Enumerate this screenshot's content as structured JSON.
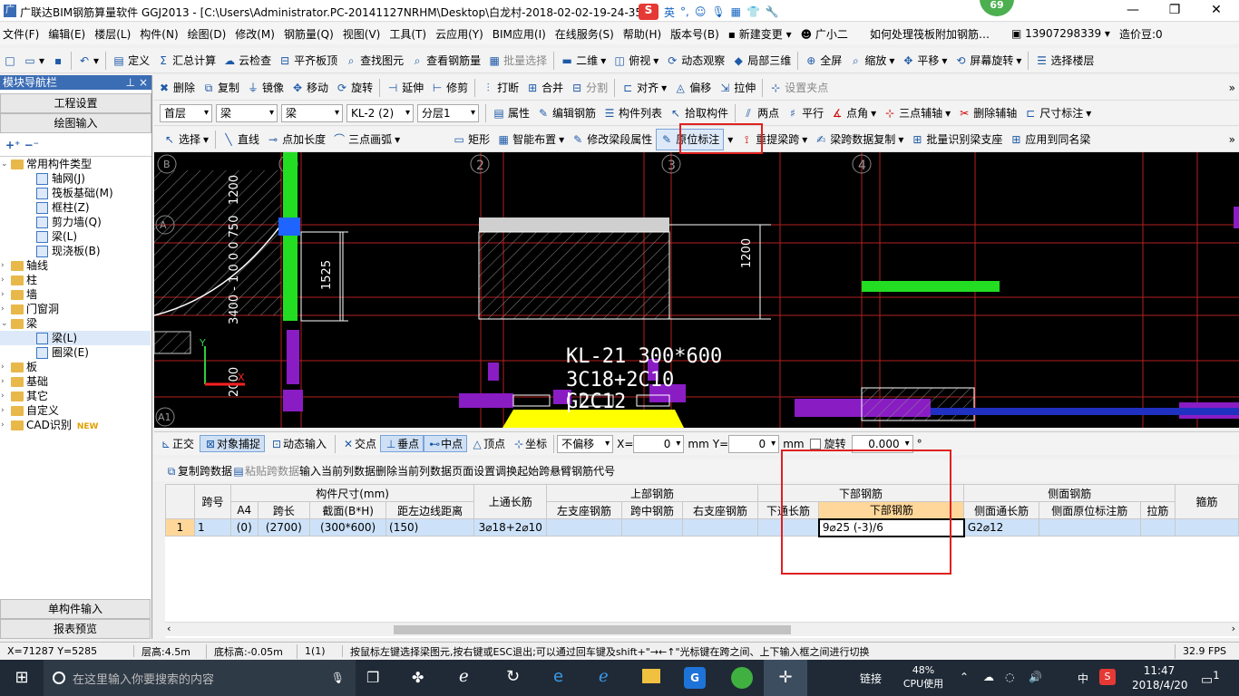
{
  "titlebar": {
    "title": "广联达BIM钢筋算量软件 GGJ2013 - [C:\\Users\\Administrator.PC-20141127NRHM\\Desktop\\白龙村-2018-02-02-19-24-35",
    "ime_en": "英",
    "notification_count": "69"
  },
  "menu": [
    "文件(F)",
    "编辑(E)",
    "楼层(L)",
    "构件(N)",
    "绘图(D)",
    "修改(M)",
    "钢筋量(Q)",
    "视图(V)",
    "工具(T)",
    "云应用(Y)",
    "BIM应用(I)",
    "在线服务(S)",
    "帮助(H)",
    "版本号(B)",
    "新建变更",
    "广小二",
    "如何处理筏板附加钢筋…",
    "13907298339",
    "造价豆:0"
  ],
  "toolbar1": {
    "items": [
      "定义",
      "汇总计算",
      "云检查",
      "平齐板顶",
      "查找图元",
      "查看钢筋量",
      "批量选择",
      "二维",
      "俯视",
      "动态观察",
      "局部三维",
      "全屏",
      "缩放",
      "平移",
      "屏幕旋转",
      "选择楼层"
    ]
  },
  "toolbar2": {
    "items": [
      "删除",
      "复制",
      "镜像",
      "移动",
      "旋转",
      "延伸",
      "修剪",
      "打断",
      "合并",
      "分割",
      "对齐",
      "偏移",
      "拉伸",
      "设置夹点"
    ]
  },
  "toolbar3": {
    "floor": "首层",
    "type1": "梁",
    "type2": "梁",
    "component": "KL-2 (2)",
    "layer": "分层1",
    "items": [
      "属性",
      "编辑钢筋",
      "构件列表",
      "拾取构件",
      "两点",
      "平行",
      "点角",
      "三点辅轴",
      "删除辅轴",
      "尺寸标注"
    ]
  },
  "toolbar4": {
    "items": [
      "选择",
      "直线",
      "点加长度",
      "三点画弧",
      "矩形",
      "智能布置",
      "修改梁段属性",
      "原位标注",
      "重提梁跨",
      "梁跨数据复制",
      "批量识别梁支座",
      "应用到同名梁"
    ]
  },
  "nav": {
    "header": "模块导航栏",
    "btn_project": "工程设置",
    "btn_draw": "绘图输入",
    "btn_single": "单构件输入",
    "btn_report": "报表预览",
    "tree": [
      {
        "label": "常用构件类型",
        "level": 0,
        "type": "folder",
        "open": true
      },
      {
        "label": "轴网(J)",
        "level": 1,
        "type": "leaf"
      },
      {
        "label": "筏板基础(M)",
        "level": 1,
        "type": "leaf"
      },
      {
        "label": "框柱(Z)",
        "level": 1,
        "type": "leaf"
      },
      {
        "label": "剪力墙(Q)",
        "level": 1,
        "type": "leaf"
      },
      {
        "label": "梁(L)",
        "level": 1,
        "type": "leaf"
      },
      {
        "label": "现浇板(B)",
        "level": 1,
        "type": "leaf"
      },
      {
        "label": "轴线",
        "level": 0,
        "type": "folder"
      },
      {
        "label": "柱",
        "level": 0,
        "type": "folder"
      },
      {
        "label": "墙",
        "level": 0,
        "type": "folder"
      },
      {
        "label": "门窗洞",
        "level": 0,
        "type": "folder"
      },
      {
        "label": "梁",
        "level": 0,
        "type": "folder",
        "open": true
      },
      {
        "label": "梁(L)",
        "level": 1,
        "type": "leaf",
        "selected": true
      },
      {
        "label": "圈梁(E)",
        "level": 1,
        "type": "leaf"
      },
      {
        "label": "板",
        "level": 0,
        "type": "folder"
      },
      {
        "label": "基础",
        "level": 0,
        "type": "folder"
      },
      {
        "label": "其它",
        "level": 0,
        "type": "folder"
      },
      {
        "label": "自定义",
        "level": 0,
        "type": "folder"
      },
      {
        "label": "CAD识别",
        "level": 0,
        "type": "folder",
        "badge": "NEW"
      }
    ]
  },
  "cad": {
    "axes": [
      "2",
      "3",
      "4"
    ],
    "axis_b": "B",
    "axis_a": "A",
    "axis_a1": "A1",
    "dim_1200_top": "1200",
    "dim_1525": "1525",
    "dim_1200_right": "1200",
    "dim_left_vert": "3400 - 1 0 0 0 750",
    "dim_left_vert2": "2000",
    "beam_label1": "KL-21  300*600",
    "beam_label2": "3C18+2C10",
    "beam_label3": "G2C12"
  },
  "snapbar": {
    "items": [
      "正交",
      "对象捕捉",
      "动态输入",
      "交点",
      "垂点",
      "中点",
      "顶点",
      "坐标"
    ],
    "offset": "不偏移",
    "x_label": "X=",
    "x_val": "0",
    "y_label": "Y=",
    "y_val": "0",
    "unit": "mm",
    "rotate": "旋转",
    "rotate_val": "0.000",
    "deg": "°"
  },
  "gridtools": [
    "复制跨数据",
    "粘贴跨数据",
    "输入当前列数据",
    "删除当前列数据",
    "页面设置",
    "调换起始跨",
    "悬臂钢筋代号"
  ],
  "grid": {
    "h_span": "跨号",
    "h_size": "构件尺寸(mm)",
    "h_top_long": "上通长筋",
    "h_top": "上部钢筋",
    "h_bottom": "下部钢筋",
    "h_side": "侧面钢筋",
    "h_stirrup": "箍筋",
    "sub": [
      "A4",
      "跨长",
      "截面(B*H)",
      "距左边线距离",
      "左支座钢筋",
      "跨中钢筋",
      "右支座钢筋",
      "下通长筋",
      "下部钢筋",
      "侧面通长筋",
      "侧面原位标注筋",
      "拉筋"
    ],
    "row": {
      "idx": "1",
      "span": "1",
      "a4": "(0)",
      "len": "(2700)",
      "sec": "(300*600)",
      "dist": "(150)",
      "top_long": "3⌀18+2⌀10",
      "left": "",
      "mid": "",
      "right": "",
      "bot_long": "",
      "bottom": "9⌀25 (-3)/6",
      "side_long": "G2⌀12",
      "side_pos": "",
      "tie": ""
    }
  },
  "status": {
    "coords": "X=71287 Y=5285",
    "floor_h": "层高:4.5m",
    "bottom_h": "底标高:-0.05m",
    "count": "1(1)",
    "hint": "按鼠标左键选择梁图元,按右键或ESC退出;可以通过回车键及shift+\"→←↑\"光标键在跨之间、上下输入框之间进行切换",
    "fps": "32.9 FPS"
  },
  "taskbar": {
    "search": "在这里输入你要搜索的内容",
    "link": "链接",
    "cpu_pct": "48%",
    "cpu_label": "CPU使用",
    "lang": "中",
    "time": "11:47",
    "date": "2018/4/20",
    "notif": "1"
  }
}
